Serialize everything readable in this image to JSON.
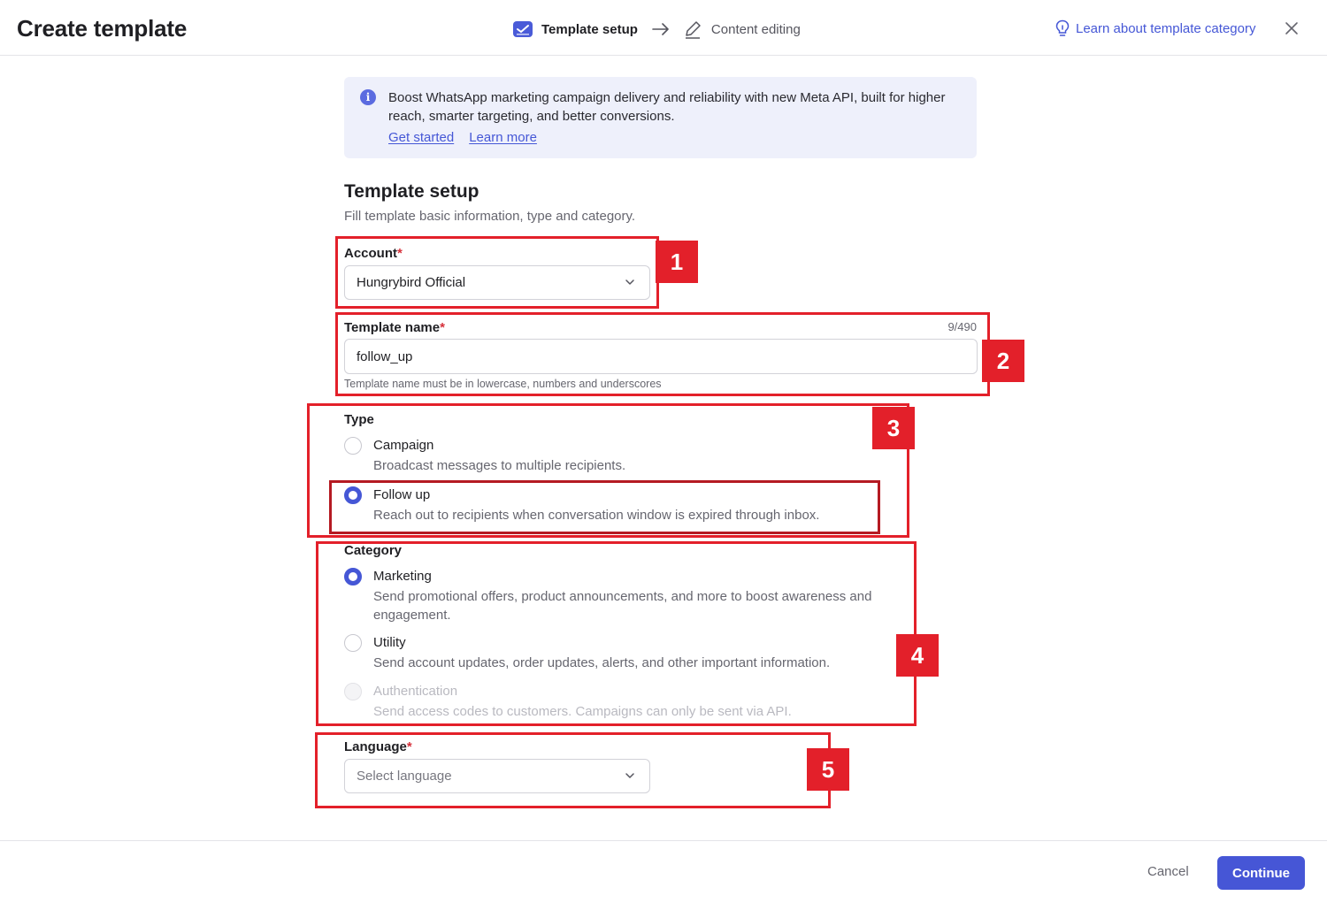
{
  "header": {
    "title": "Create template",
    "steps": [
      {
        "label": "Template setup",
        "active": true,
        "icon": "template-setup-icon"
      },
      {
        "label": "Content editing",
        "active": false,
        "icon": "pencil-icon"
      }
    ],
    "learn_link": "Learn about template category"
  },
  "banner": {
    "text": "Boost WhatsApp marketing campaign delivery and reliability with new Meta API, built for higher reach, smarter targeting, and better conversions.",
    "info_glyph": "i",
    "links": [
      "Get started",
      "Learn more"
    ]
  },
  "section": {
    "title": "Template setup",
    "subtitle": "Fill template basic information, type and category."
  },
  "account": {
    "label": "Account",
    "required_mark": "*",
    "value": "Hungrybird Official"
  },
  "template_name": {
    "label": "Template name",
    "required_mark": "*",
    "value": "follow_up",
    "counter": "9/490",
    "hint": "Template name must be in lowercase, numbers and underscores"
  },
  "type": {
    "label": "Type",
    "options": [
      {
        "title": "Campaign",
        "desc": "Broadcast messages to multiple recipients.",
        "checked": false
      },
      {
        "title": "Follow up",
        "desc": "Reach out to recipients when conversation window is expired through inbox.",
        "checked": true
      }
    ]
  },
  "category": {
    "label": "Category",
    "options": [
      {
        "title": "Marketing",
        "desc": "Send promotional offers, product announcements, and more to boost awareness and engagement.",
        "checked": true
      },
      {
        "title": "Utility",
        "desc": "Send account updates, order updates, alerts, and other important information.",
        "checked": false
      },
      {
        "title": "Authentication",
        "desc": "Send access codes to customers. Campaigns can only be sent via API.",
        "checked": false,
        "disabled": true
      }
    ]
  },
  "language": {
    "label": "Language",
    "required_mark": "*",
    "placeholder": "Select language"
  },
  "annotations": [
    "1",
    "2",
    "3",
    "4",
    "5"
  ],
  "footer": {
    "cancel": "Cancel",
    "continue": "Continue"
  },
  "colors": {
    "accent": "#4557d6",
    "annotation": "#e3202a",
    "banner_bg": "#eef0fb"
  }
}
